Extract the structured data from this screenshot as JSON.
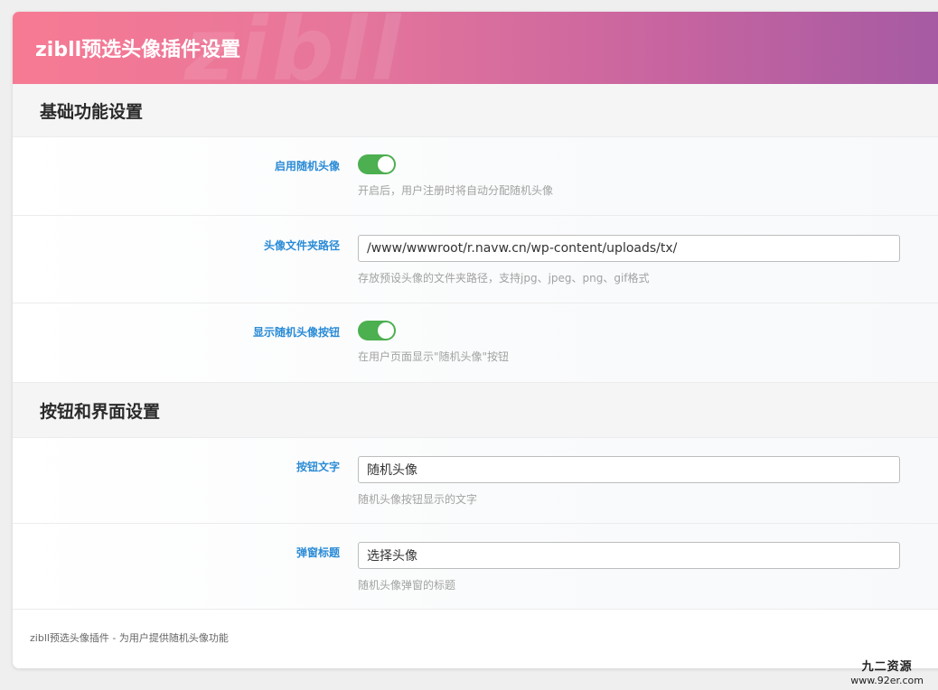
{
  "header": {
    "title": "zibll预选头像插件设置",
    "watermark": "zibll"
  },
  "sections": [
    {
      "title": "基础功能设置",
      "rows": [
        {
          "label": "启用随机头像",
          "type": "toggle",
          "on": true,
          "hint": "开启后，用户注册时将自动分配随机头像"
        },
        {
          "label": "头像文件夹路径",
          "type": "text",
          "value": "/www/wwwroot/r.navw.cn/wp-content/uploads/tx/",
          "hint": "存放预设头像的文件夹路径，支持jpg、jpeg、png、gif格式"
        },
        {
          "label": "显示随机头像按钮",
          "type": "toggle",
          "on": true,
          "hint": "在用户页面显示\"随机头像\"按钮"
        }
      ]
    },
    {
      "title": "按钮和界面设置",
      "rows": [
        {
          "label": "按钮文字",
          "type": "text",
          "value": "随机头像",
          "hint": "随机头像按钮显示的文字"
        },
        {
          "label": "弹窗标题",
          "type": "text",
          "value": "选择头像",
          "hint": "随机头像弹窗的标题"
        }
      ]
    }
  ],
  "footer": {
    "text": "zibll预选头像插件 - 为用户提供随机头像功能"
  },
  "site_watermark": {
    "name": "九二资源",
    "url": "www.92er.com"
  },
  "colors": {
    "header_gradient_start": "#f77a93",
    "header_gradient_end": "#a45aa3",
    "label": "#2a8bd6",
    "toggle_on": "#4caf50",
    "hint": "#a2a2a2"
  }
}
